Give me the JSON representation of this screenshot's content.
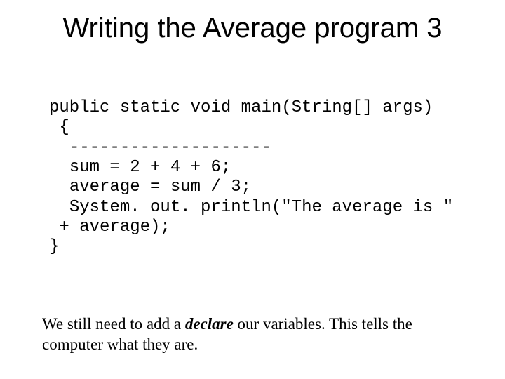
{
  "title": "Writing the Average program 3",
  "code": "public static void main(String[] args)\n {\n  --------------------\n  sum = 2 + 4 + 6;\n  average = sum / 3;\n  System. out. println(\"The average is \"\n + average);\n}",
  "body_pre": "We still need to add a ",
  "body_emph": "declare",
  "body_post": " our variables.  This tells the computer what they are."
}
